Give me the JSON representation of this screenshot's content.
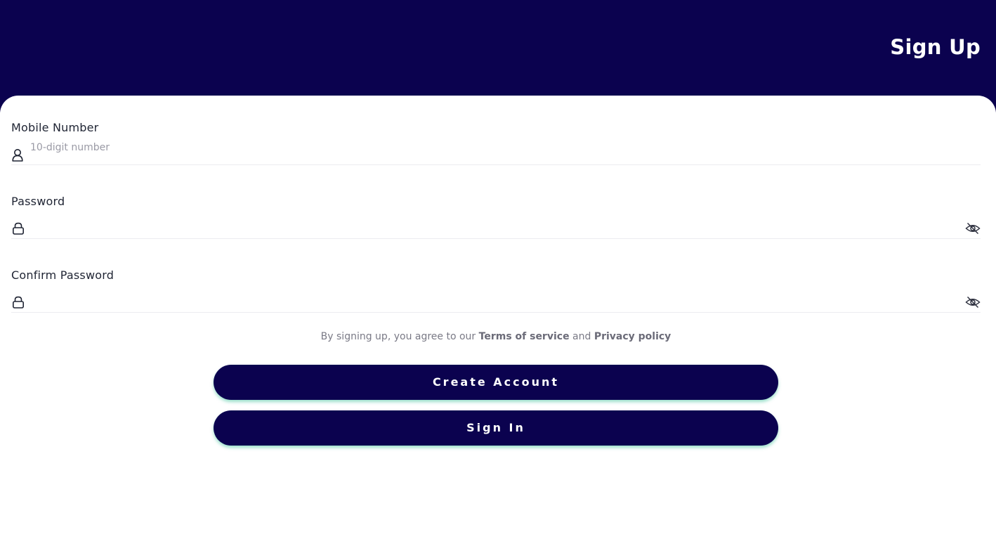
{
  "header": {
    "title": "Sign Up"
  },
  "form": {
    "mobile": {
      "label": "Mobile Number",
      "placeholder": "10-digit number",
      "value": ""
    },
    "password": {
      "label": "Password",
      "value": ""
    },
    "confirm_password": {
      "label": "Confirm Password",
      "value": ""
    }
  },
  "agreement": {
    "prefix": "By signing up, you agree to our ",
    "terms": "Terms of service",
    "conjunction": " and ",
    "privacy": "Privacy policy"
  },
  "buttons": {
    "create_account": "Create Account",
    "sign_in": "Sign In"
  },
  "icons": {
    "mobile": "user-icon",
    "password": "lock-icon",
    "toggle_visibility": "eye-off-icon"
  },
  "colors": {
    "brand": "#0b024f",
    "button_glow": "#48c4a0"
  }
}
